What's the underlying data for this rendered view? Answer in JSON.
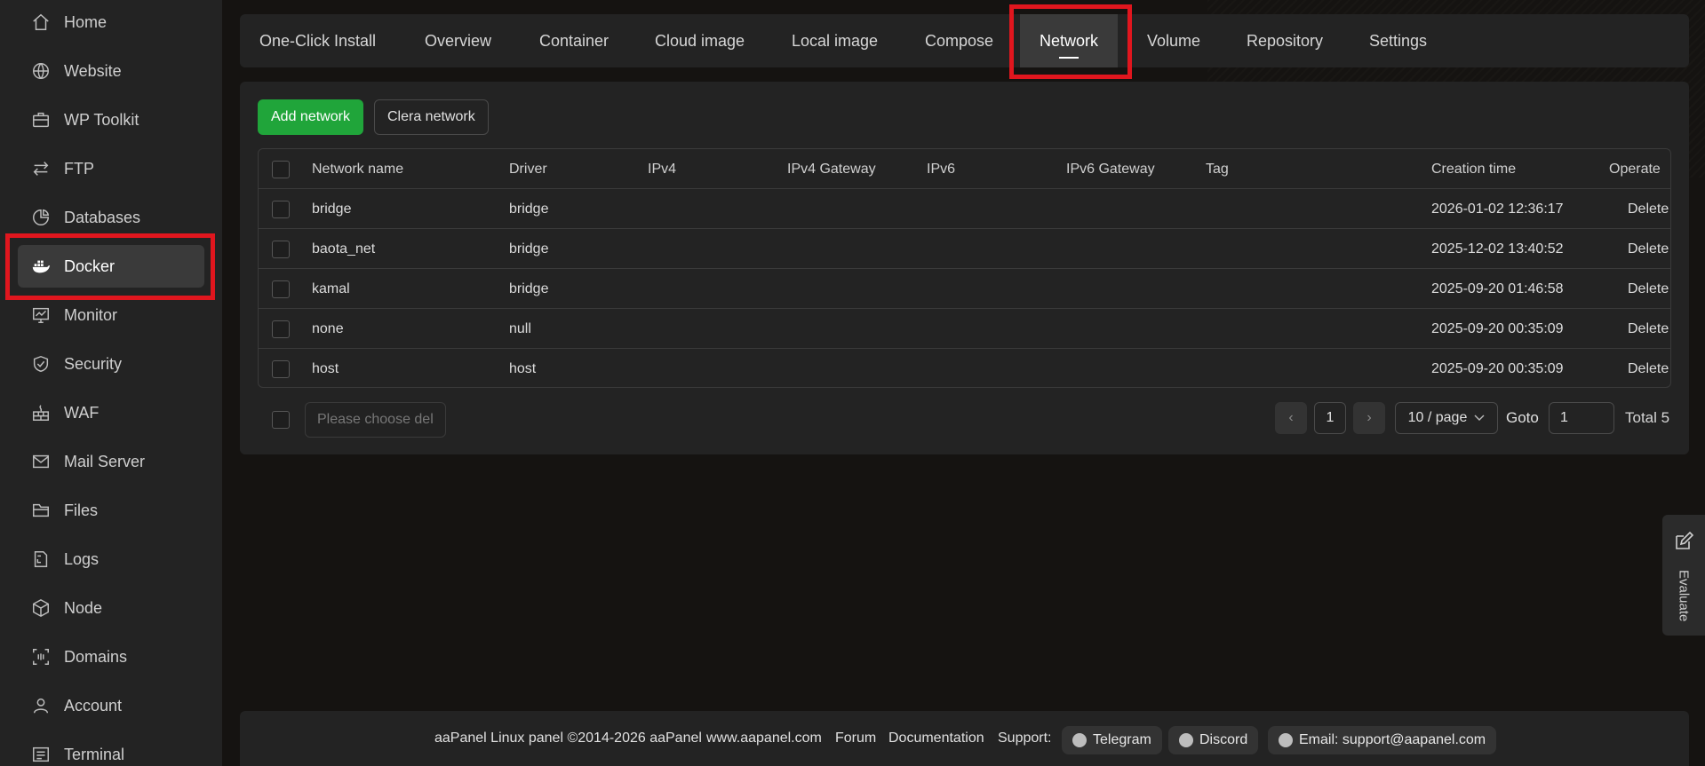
{
  "sidebar": {
    "items": [
      {
        "label": "Home",
        "icon": "home-icon"
      },
      {
        "label": "Website",
        "icon": "globe-icon"
      },
      {
        "label": "WP Toolkit",
        "icon": "toolkit-icon"
      },
      {
        "label": "FTP",
        "icon": "transfer-icon"
      },
      {
        "label": "Databases",
        "icon": "database-icon"
      },
      {
        "label": "Docker",
        "icon": "docker-icon"
      },
      {
        "label": "Monitor",
        "icon": "monitor-icon"
      },
      {
        "label": "Security",
        "icon": "shield-icon"
      },
      {
        "label": "WAF",
        "icon": "firewall-icon"
      },
      {
        "label": "Mail Server",
        "icon": "mail-icon"
      },
      {
        "label": "Files",
        "icon": "folder-icon"
      },
      {
        "label": "Logs",
        "icon": "log-icon"
      },
      {
        "label": "Node",
        "icon": "node-icon"
      },
      {
        "label": "Domains",
        "icon": "domains-icon"
      },
      {
        "label": "Account",
        "icon": "user-icon"
      },
      {
        "label": "Terminal",
        "icon": "terminal-icon"
      }
    ],
    "active": "Docker"
  },
  "tabs": [
    {
      "label": "One-Click Install"
    },
    {
      "label": "Overview"
    },
    {
      "label": "Container"
    },
    {
      "label": "Cloud image"
    },
    {
      "label": "Local image"
    },
    {
      "label": "Compose"
    },
    {
      "label": "Network"
    },
    {
      "label": "Volume"
    },
    {
      "label": "Repository"
    },
    {
      "label": "Settings"
    }
  ],
  "active_tab": "Network",
  "toolbar": {
    "add_label": "Add network",
    "clear_label": "Clera network"
  },
  "table": {
    "headers": {
      "name": "Network name",
      "driver": "Driver",
      "ipv4": "IPv4",
      "ipv4_gateway": "IPv4 Gateway",
      "ipv6": "IPv6",
      "ipv6_gateway": "IPv6 Gateway",
      "tag": "Tag",
      "created": "Creation time",
      "operate": "Operate"
    },
    "rows": [
      {
        "name": "bridge",
        "driver": "bridge",
        "created": "2026-01-02 12:36:17",
        "action": "Delete"
      },
      {
        "name": "baota_net",
        "driver": "bridge",
        "created": "2025-12-02 13:40:52",
        "action": "Delete"
      },
      {
        "name": "kamal",
        "driver": "bridge",
        "created": "2025-09-20 01:46:58",
        "action": "Delete"
      },
      {
        "name": "none",
        "driver": "null",
        "created": "2025-09-20 00:35:09",
        "action": "Delete"
      },
      {
        "name": "host",
        "driver": "host",
        "created": "2025-09-20 00:35:09",
        "action": "Delete"
      }
    ]
  },
  "batch": {
    "placeholder": "Please choose del"
  },
  "pagination": {
    "prev": "‹",
    "current": "1",
    "next": "›",
    "page_size": "10 / page",
    "goto_label": "Goto",
    "goto_value": "1",
    "total": "Total 5"
  },
  "evaluate": {
    "label": "Evaluate"
  },
  "footer": {
    "copyright": "aaPanel Linux panel ©2014-2026 aaPanel",
    "site": "www.aapanel.com",
    "forum": "Forum",
    "docs": "Documentation",
    "support": "Support:",
    "telegram": "Telegram",
    "discord": "Discord",
    "email": "Email: support@aapanel.com"
  },
  "colors": {
    "accent_green": "#20a53a",
    "highlight_red": "#e0161e",
    "panel_bg": "#232323",
    "page_bg": "#151311"
  }
}
